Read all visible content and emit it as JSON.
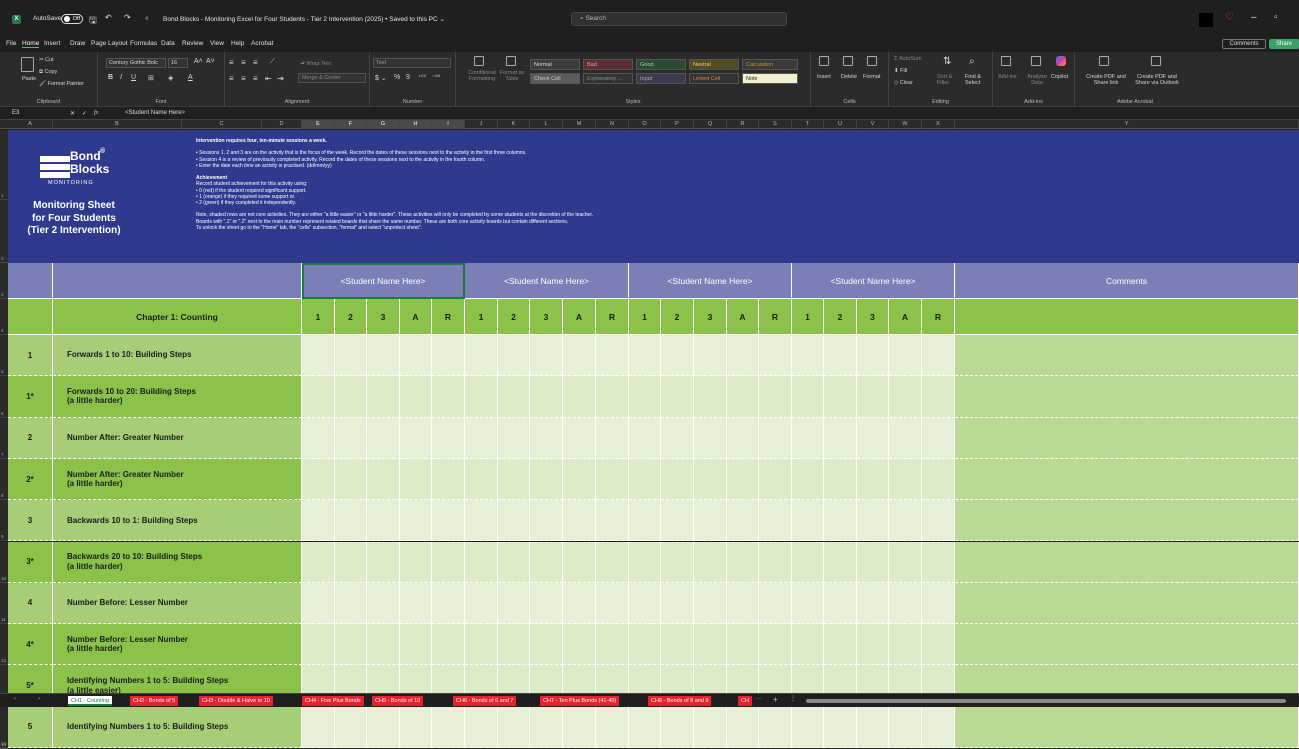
{
  "titlebar": {
    "autosave": "AutoSave",
    "autosave_state": "Off",
    "doc_title": "Bond Blocks - Monitoring Excel for Four Students - Tier 2 Intervention (2025) • Saved to this PC ⌄",
    "search_placeholder": "Search"
  },
  "menu": {
    "items": [
      "File",
      "Home",
      "Insert",
      "Draw",
      "Page Layout",
      "Formulas",
      "Data",
      "Review",
      "View",
      "Help",
      "Acrobat"
    ],
    "comments": "Comments",
    "share": "Share"
  },
  "ribbon": {
    "clipboard": {
      "label": "Clipboard",
      "paste": "Paste",
      "cut": "Cut",
      "copy": "Copy",
      "format_painter": "Format Painter"
    },
    "font": {
      "label": "Font",
      "name": "Century Gothic Bolc",
      "size": "16"
    },
    "alignment": {
      "label": "Alignment",
      "wrap": "Wrap Text",
      "merge": "Merge & Center"
    },
    "number": {
      "label": "Number",
      "format": "Text"
    },
    "styles": {
      "label": "Styles",
      "conditional": "Conditional Formatting",
      "format_table": "Format as Table",
      "cells": [
        "Normal",
        "Bad",
        "Good",
        "Neutral",
        "Calculation",
        "Check Cell",
        "Explanatory ...",
        "Input",
        "Linked Cell",
        "Note"
      ]
    },
    "cells": {
      "label": "Cells",
      "insert": "Insert",
      "delete": "Delete",
      "format": "Format"
    },
    "editing": {
      "label": "Editing",
      "autosum": "AutoSum",
      "fill": "Fill",
      "clear": "Clear",
      "sort": "Sort & Filter",
      "find": "Find & Select"
    },
    "addins": {
      "label": "Add-ins",
      "addins": "Add-ins",
      "analyze": "Analyze Data",
      "copilot": "Copilot"
    },
    "acrobat": {
      "label": "Adobe Acrobat",
      "create_share": "Create PDF and Share link",
      "create_outlook": "Create PDF and Share via Outlook"
    }
  },
  "formula_bar": {
    "cell_ref": "E3",
    "fx": "fx",
    "content": "<Student Name Here>"
  },
  "columns": [
    "A",
    "B",
    "C",
    "D",
    "E",
    "F",
    "G",
    "H",
    "I",
    "J",
    "K",
    "L",
    "M",
    "N",
    "O",
    "P",
    "Q",
    "R",
    "S",
    "T",
    "U",
    "V",
    "W",
    "X",
    "Y"
  ],
  "banner": {
    "logo_top": "Bond",
    "logo_reg": "®",
    "logo_bottom": "Blocks",
    "logo_sub": "MONITORING",
    "title_lines": [
      "Monitoring Sheet",
      "for Four Students",
      "(Tier 2 Intervention)"
    ],
    "instructions": [
      "Intervention requires four, ten-minute sessions a week.",
      "",
      "•  Sessions 1, 2 and 3 are on the activity that is the focus of the week. Record the dates of these sessions next to the activity in the first three columns.",
      "•  Session 4 is a review of previously completed activity. Record the dates of these sessions next to the activity in the fourth column.",
      "•  Enter the date each time an activity is practised. (dd/mm/yy)",
      "",
      "Achievement",
      "Record student achievement for this activity using:",
      "•  0 (red) if the student required significant support.",
      "•  1 (orange) if they required some support or.",
      "•  2 (green) if they completed it independently.",
      "",
      "Note, shaded rows are not core activities. They are either \"a little easier\" or \"a little harder\". These activities will only be completed by some students at the discretion of the teacher.",
      "Boards with \".1\" or \".2\" next to the main number represent related boards that share the same number. These are both core activity boards but contain different sections.",
      "To unlock the sheet go to the \"Home\" tab, the \"cells\" subsection, \"format\" and  select \"unprotect sheet\"."
    ]
  },
  "table": {
    "student_headers": [
      "<Student Name Here>",
      "<Student Name Here>",
      "<Student Name Here>",
      "<Student Name Here>"
    ],
    "comments_header": "Comments",
    "chapter": "Chapter 1: Counting",
    "session_cols": [
      "1",
      "2",
      "3",
      "A",
      "R"
    ],
    "rows": [
      {
        "num": "1",
        "activity": [
          "Forwards 1 to 10: Building Steps"
        ],
        "alt": false
      },
      {
        "num": "1*",
        "activity": [
          "Forwards 10 to 20: Building Steps",
          "(a little harder)"
        ],
        "alt": true
      },
      {
        "num": "2",
        "activity": [
          "Number After: Greater Number"
        ],
        "alt": false
      },
      {
        "num": "2*",
        "activity": [
          "Number After: Greater Number",
          "(a little harder)"
        ],
        "alt": true
      },
      {
        "num": "3",
        "activity": [
          "Backwards 10 to 1: Building Steps"
        ],
        "alt": false
      },
      {
        "num": "3*",
        "activity": [
          "Backwards 20 to 10: Building Steps",
          "(a little harder)"
        ],
        "alt": true
      },
      {
        "num": "4",
        "activity": [
          "Number Before: Lesser Number"
        ],
        "alt": false
      },
      {
        "num": "4*",
        "activity": [
          "Number Before: Lesser Number",
          "(a little harder)"
        ],
        "alt": true
      },
      {
        "num": "5*",
        "activity": [
          "Identifying Numbers 1 to 5: Building Steps",
          "(a little easier)"
        ],
        "alt": true
      },
      {
        "num": "5",
        "activity": [
          "Identifying Numbers 1 to 5: Building Steps"
        ],
        "alt": false
      }
    ],
    "row_numbers": [
      "1",
      "2",
      "3",
      "4",
      "5",
      "6",
      "7",
      "8",
      "9",
      "10",
      "11",
      "12",
      "13",
      "14",
      "15"
    ]
  },
  "sheets": {
    "tabs": [
      "CH1 - Counting",
      "CH2 - Bonds of 5",
      "CH3 - Double & Halve to 10",
      "CH4 - Five Plus Bonds",
      "CH5 - Bonds of 10",
      "CH6 - Bonds of 6 and 7",
      "CH7 - Ten Plus Bonds (41-49)",
      "CH6 - Bonds of 8 and 9",
      "CH"
    ],
    "active": 0
  },
  "colors": {
    "banner": "#2f3a8f",
    "header": "#7b7fb8",
    "chapter": "#8bc34a",
    "row_light": "#a7cd76",
    "cell": "#e6f0d7",
    "tab": "#e8212f"
  }
}
